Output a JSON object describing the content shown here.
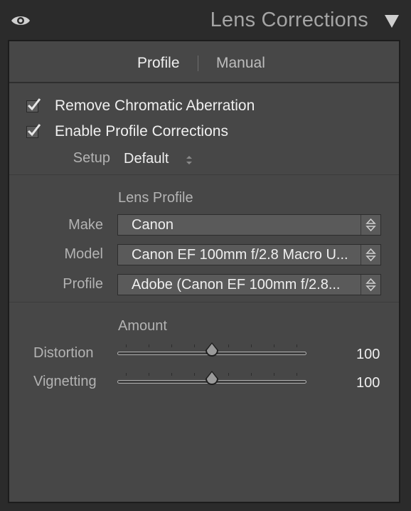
{
  "panel": {
    "title": "Lens Corrections"
  },
  "tabs": {
    "profile": "Profile",
    "manual": "Manual"
  },
  "checks": {
    "chromatic": {
      "label": "Remove Chromatic Aberration",
      "checked": true
    },
    "profile_corrections": {
      "label": "Enable Profile Corrections",
      "checked": true
    }
  },
  "setup": {
    "label": "Setup",
    "value": "Default"
  },
  "lens_profile": {
    "title": "Lens Profile",
    "make": {
      "label": "Make",
      "value": "Canon"
    },
    "model": {
      "label": "Model",
      "value": "Canon EF 100mm f/2.8 Macro U..."
    },
    "profile": {
      "label": "Profile",
      "value": "Adobe (Canon EF 100mm f/2.8..."
    }
  },
  "amount": {
    "title": "Amount",
    "distortion": {
      "label": "Distortion",
      "value": "100",
      "fraction": 0.5
    },
    "vignetting": {
      "label": "Vignetting",
      "value": "100",
      "fraction": 0.5
    }
  },
  "colors": {
    "panel_bg": "#474747",
    "header_bg": "#2b2b2b",
    "text_active": "#efefef",
    "text_label": "#b3b3b3"
  }
}
